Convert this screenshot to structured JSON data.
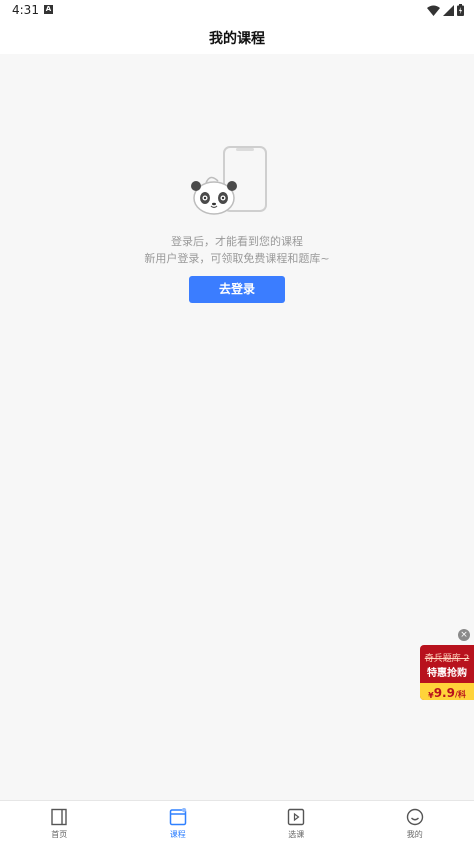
{
  "status_bar": {
    "time": "4:31",
    "notification_letter": "A"
  },
  "header": {
    "title": "我的课程"
  },
  "empty_state": {
    "line1": "登录后，才能看到您的课程",
    "line2": "新用户登录，可领取免费课程和题库~",
    "button_label": "去登录"
  },
  "promo": {
    "line1": "奇兵题库 2",
    "line2": "特惠抢购",
    "currency": "¥",
    "price": "9.9",
    "unit": "/科",
    "close": "×"
  },
  "tabs": [
    {
      "label": "首页",
      "icon": "home-icon"
    },
    {
      "label": "课程",
      "icon": "course-icon",
      "active": true
    },
    {
      "label": "选课",
      "icon": "select-course-icon"
    },
    {
      "label": "我的",
      "icon": "profile-icon"
    }
  ],
  "colors": {
    "accent": "#3b7dff",
    "promo_red": "#b8121d",
    "promo_yellow": "#ffd33a"
  }
}
